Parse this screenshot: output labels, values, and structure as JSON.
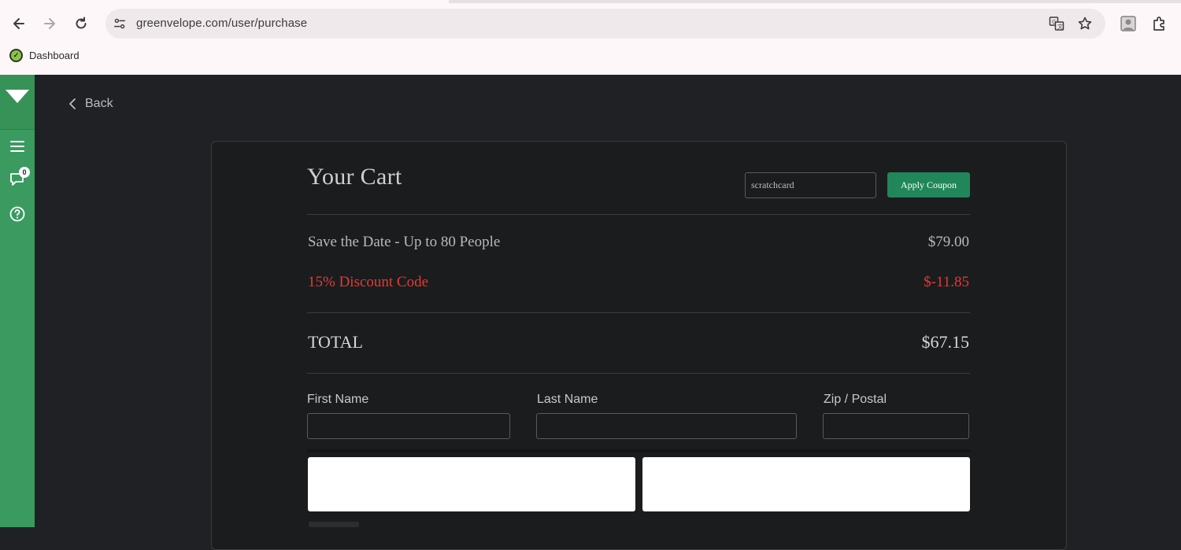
{
  "browser": {
    "url": "greenvelope.com/user/purchase",
    "bookmark_label": "Dashboard",
    "bookmark_icon": "greenvelope-favicon"
  },
  "sidebar": {
    "notification_count": "0",
    "icons": [
      "greenvelope-logo-icon",
      "hamburger-menu-icon",
      "chat-icon",
      "help-icon"
    ]
  },
  "main": {
    "back_label": "Back",
    "cart": {
      "title": "Your Cart",
      "coupon_value": "scratchcard",
      "apply_coupon_label": "Apply Coupon",
      "lines": [
        {
          "label": "Save the Date - Up to 80 People",
          "value": "$79.00"
        },
        {
          "label": "15% Discount Code",
          "value": "$-11.85"
        }
      ],
      "total_label": "TOTAL",
      "total_value": "$67.15"
    },
    "form": {
      "first_name_label": "First Name",
      "last_name_label": "Last Name",
      "zip_label": "Zip / Postal",
      "first_name_value": "",
      "last_name_value": "",
      "zip_value": ""
    }
  },
  "colors": {
    "sidebar_green": "#3a9a60",
    "button_green": "#21875a",
    "discount_red": "#e53935",
    "background": "#202124",
    "card": "#1b1c1d"
  }
}
